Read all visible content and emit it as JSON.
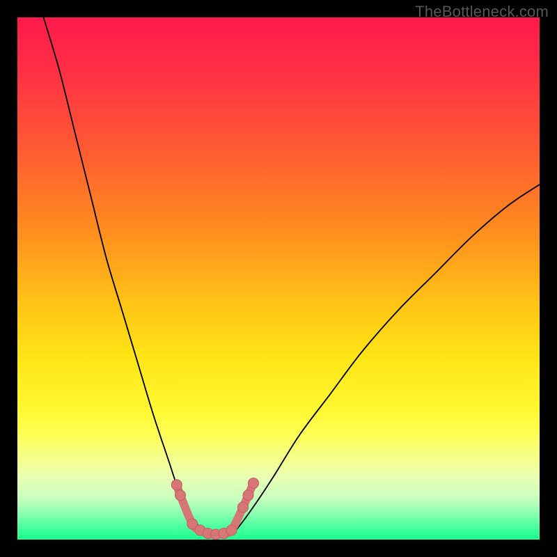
{
  "watermark": {
    "text": "TheBottleneck.com"
  },
  "colors": {
    "black": "#000000",
    "curve_stroke": "#000000",
    "marker_fill": "#d77676",
    "marker_stroke": "#c85f5f"
  },
  "gradient_stops": [
    {
      "offset": 0.0,
      "color": "#ff1a4b"
    },
    {
      "offset": 0.1,
      "color": "#ff2f45"
    },
    {
      "offset": 0.25,
      "color": "#ff5a33"
    },
    {
      "offset": 0.4,
      "color": "#ff8a1f"
    },
    {
      "offset": 0.55,
      "color": "#ffc415"
    },
    {
      "offset": 0.65,
      "color": "#ffe516"
    },
    {
      "offset": 0.75,
      "color": "#fff830"
    },
    {
      "offset": 0.8,
      "color": "#fdff55"
    },
    {
      "offset": 0.84,
      "color": "#f6ff87"
    },
    {
      "offset": 0.88,
      "color": "#e9ffb3"
    },
    {
      "offset": 0.92,
      "color": "#c9ffbf"
    },
    {
      "offset": 0.95,
      "color": "#8bffb0"
    },
    {
      "offset": 0.975,
      "color": "#4dff9e"
    },
    {
      "offset": 1.0,
      "color": "#1aff8f"
    }
  ],
  "chart_data": {
    "type": "line",
    "title": "",
    "xlabel": "",
    "ylabel": "",
    "xlim": [
      0,
      100
    ],
    "ylim": [
      0,
      100
    ],
    "grid": false,
    "series": [
      {
        "name": "left-curve",
        "x": [
          5,
          8,
          11,
          14,
          17,
          20,
          23,
          26,
          29,
          31,
          32.5,
          34,
          35.5,
          37
        ],
        "y": [
          100,
          90,
          78,
          66,
          54,
          44,
          34,
          24,
          15,
          9,
          6,
          3.5,
          1.8,
          0.5
        ]
      },
      {
        "name": "right-curve",
        "x": [
          40,
          42,
          45,
          49,
          54,
          60,
          66,
          73,
          80,
          87,
          94,
          100
        ],
        "y": [
          0.5,
          2,
          6,
          12,
          20,
          28,
          36,
          44,
          51,
          58,
          64,
          68
        ]
      },
      {
        "name": "bottom-markers",
        "x": [
          30.5,
          31.2,
          33.5,
          35.0,
          36.5,
          38.0,
          39.5,
          41.0,
          43.2,
          44.2,
          45.2
        ],
        "y": [
          10.5,
          8.5,
          3.0,
          1.8,
          1.2,
          1.0,
          1.2,
          1.8,
          6.2,
          8.5,
          10.8
        ]
      }
    ]
  }
}
